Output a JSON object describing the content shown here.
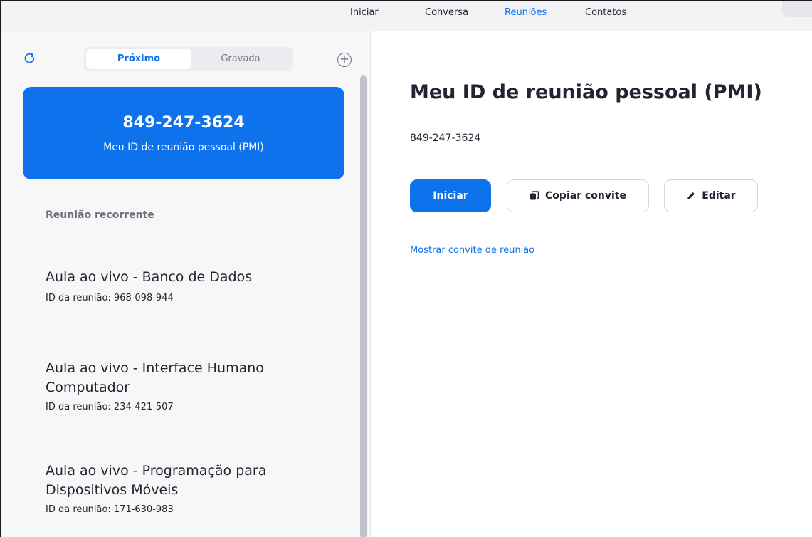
{
  "nav": {
    "tabs": [
      "Iniciar",
      "Conversa",
      "Reuniões",
      "Contatos"
    ],
    "active": "Reuniões",
    "accent": "#0e72ed"
  },
  "sidebar": {
    "segments": {
      "upcoming": "Próximo",
      "recorded": "Gravada"
    },
    "pmi_card": {
      "number": "849-247-3624",
      "label": "Meu ID de reunião pessoal (PMI)"
    },
    "section_title": "Reunião recorrente",
    "meetings": [
      {
        "name": "Aula ao vivo - Banco de Dados",
        "id_line": "ID da reunião: 968-098-944"
      },
      {
        "name": "Aula ao vivo - Interface Humano Computador",
        "id_line": "ID da reunião: 234-421-507"
      },
      {
        "name": "Aula ao vivo - Programação para Dispositivos Móveis",
        "id_line": "ID da reunião: 171-630-983"
      }
    ]
  },
  "main": {
    "title": "Meu ID de reunião pessoal (PMI)",
    "pmi": "849-247-3624",
    "buttons": {
      "start": "Iniciar",
      "copy": "Copiar convite",
      "edit": "Editar"
    },
    "show_invite": "Mostrar convite de reunião"
  },
  "icons": [
    "refresh-icon",
    "add-meeting-icon",
    "copy-icon",
    "pencil-icon"
  ]
}
